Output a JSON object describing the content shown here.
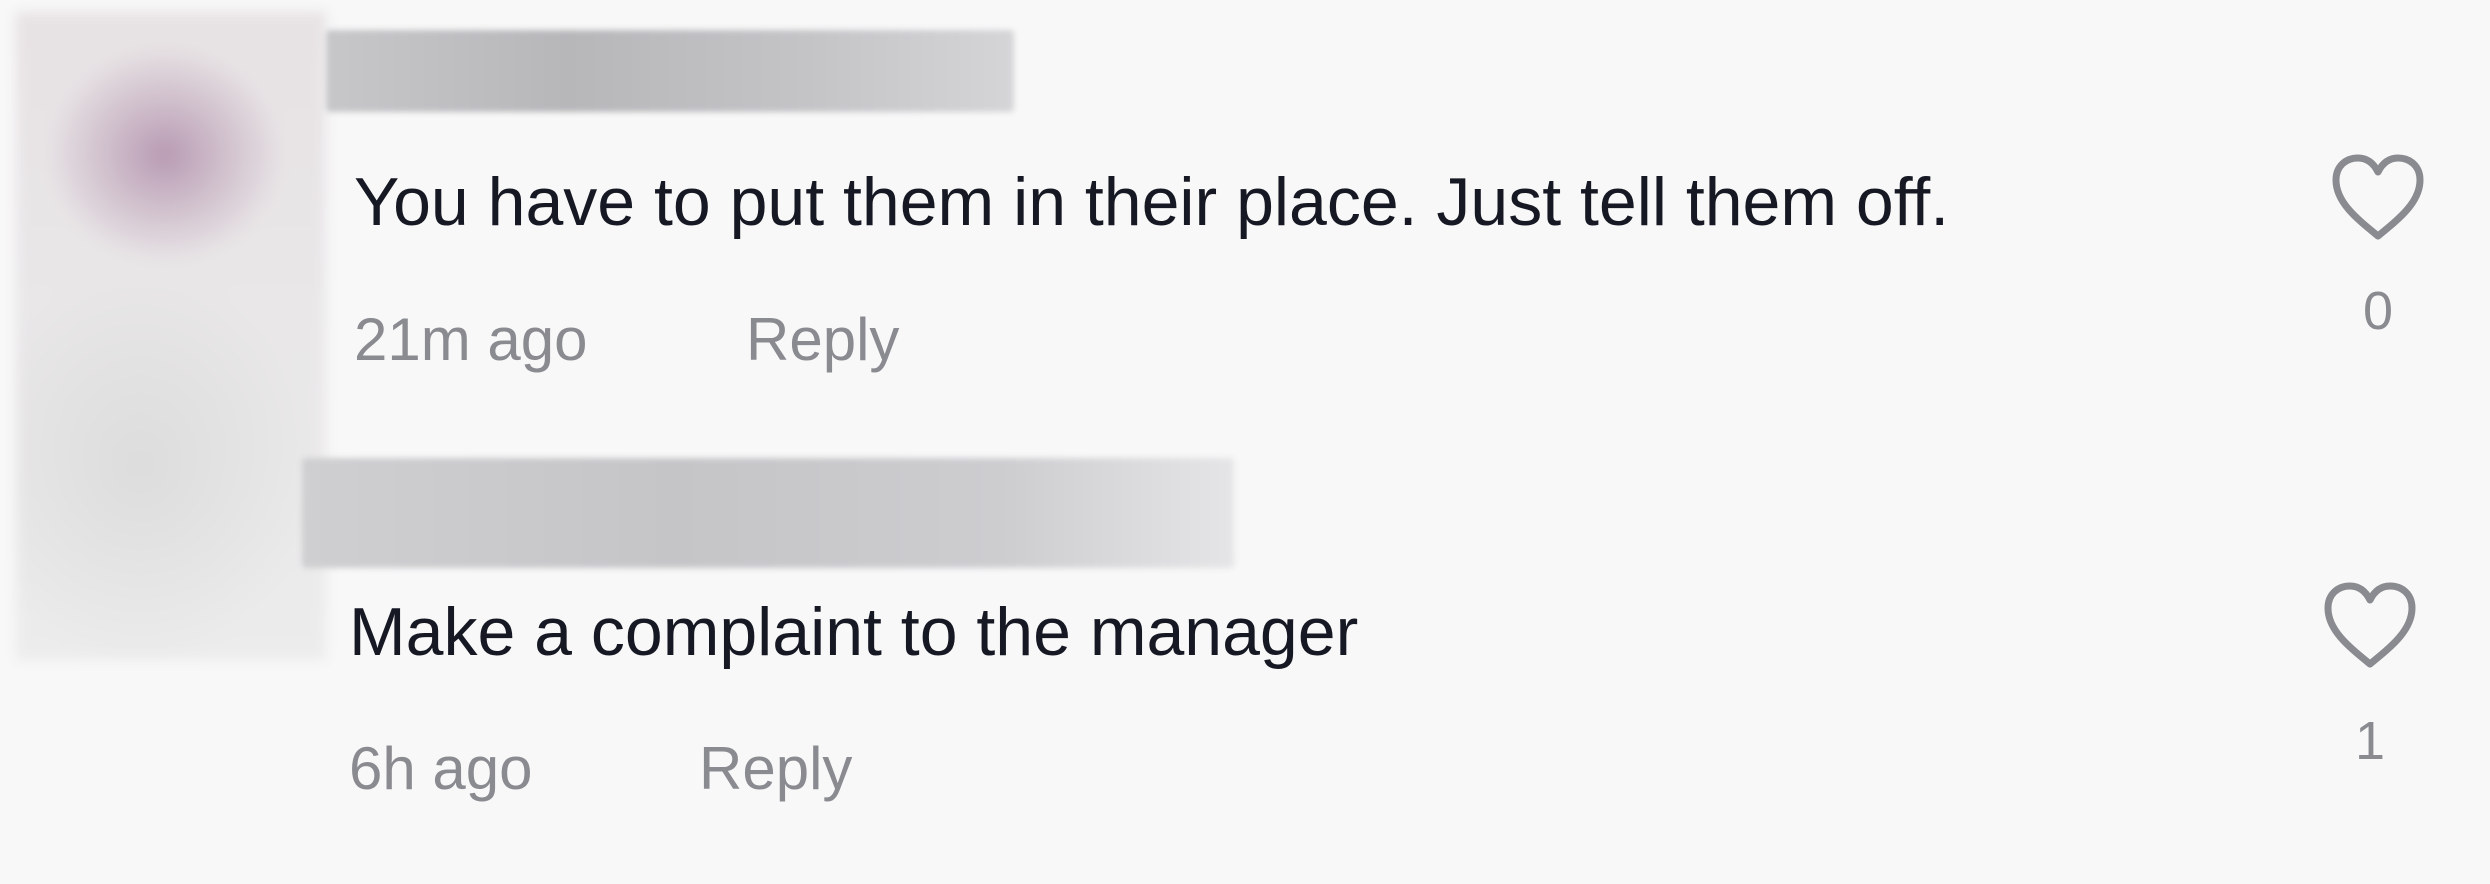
{
  "comments": [
    {
      "text": "You have to put them in their place. Just tell them off.",
      "time": "21m ago",
      "reply_label": "Reply",
      "likes": "0",
      "like_icon": "heart-outline-icon"
    },
    {
      "text": "Make a complaint to the manager",
      "time": "6h ago",
      "reply_label": "Reply",
      "likes": "1",
      "like_icon": "heart-outline-icon"
    }
  ],
  "colors": {
    "background": "#f8f8f8",
    "text": "#161823",
    "meta": "#8a8b91",
    "icon": "#8a8b91"
  }
}
